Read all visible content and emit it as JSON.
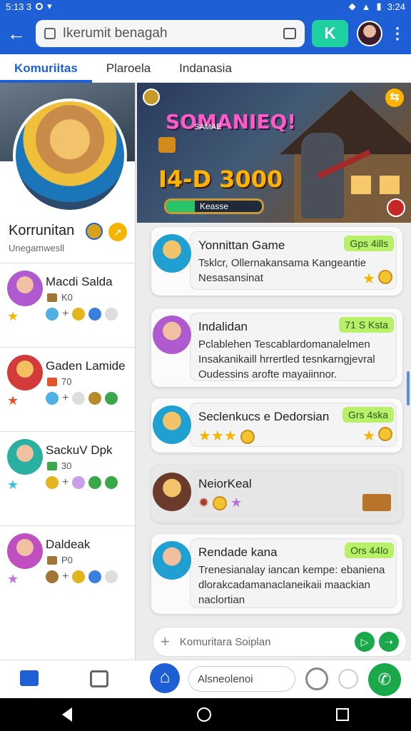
{
  "status": {
    "time_left": "5:13 3",
    "time_right": "3:24"
  },
  "search": {
    "placeholder": "Ikerumit benagah"
  },
  "tabs": [
    {
      "label": "Komuriitas"
    },
    {
      "label": "Plaroela"
    },
    {
      "label": "Indanasia"
    }
  ],
  "profile": {
    "name": "Korrunitan",
    "subtitle": "Unegamwesll"
  },
  "friends": [
    {
      "name": "Macdi Salda",
      "rank": "K0",
      "plus": "+"
    },
    {
      "name": "Gaden Lamide",
      "rank": "70",
      "plus": "+"
    },
    {
      "name": "SackuV Dpk",
      "rank": "30",
      "plus": "+"
    },
    {
      "name": "Daldeak",
      "rank": "P0",
      "plus": "+"
    }
  ],
  "banner": {
    "title": "SOMANIEQ!",
    "subtitle": "SAMAE",
    "score": "I4-D 3000",
    "progress_label": "Keasse",
    "progress": 0.3
  },
  "feed": [
    {
      "title": "Yonnittan Game",
      "tag": "Gps 4ills",
      "body": "Tsklcr, Ollernakansama Kangeantie Nesasansinat"
    },
    {
      "title": "Indalidan",
      "tag": "71 S Ksta",
      "body": "Pclablehen Tescablardomanalelmen Insakanikaill hrrertled tesnkarngjevral Oudessins arofte mayaiinnor."
    },
    {
      "title": "Seclenkucs e Dedorsian",
      "tag": "Grs 4ska",
      "body": ""
    },
    {
      "title": "NeiorKeal",
      "tag": "",
      "body": ""
    },
    {
      "title": "Rendade kana",
      "tag": "Ors 44lo",
      "body": "Trenesianalay iancan kempe: ebaniena dlorakcadamanaclaneikaii maackian naclortian"
    }
  ],
  "compose": {
    "placeholder": "Komuritara Soiplan"
  },
  "bottom": {
    "input_placeholder": "Alsneolenoi"
  },
  "colors": {
    "primary": "#1f5fd6",
    "accent_green": "#19a84a",
    "tag_green": "#b8f06a"
  }
}
